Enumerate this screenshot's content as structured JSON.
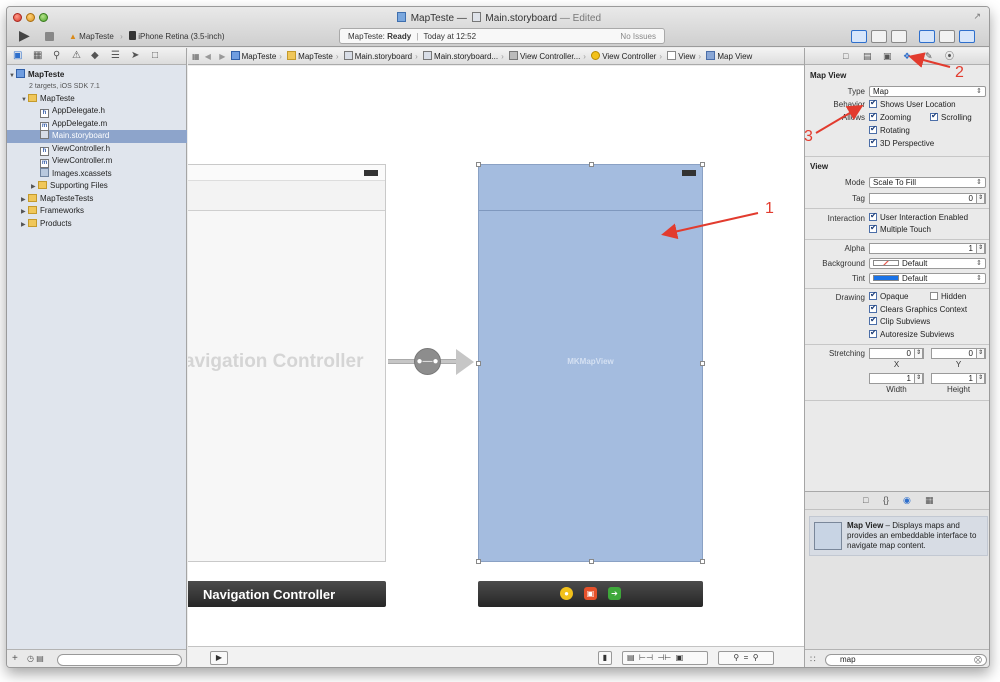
{
  "window": {
    "project": "MapTeste",
    "separator": "—",
    "file": "Main.storyboard",
    "edited": "— Edited"
  },
  "toolbar": {
    "scheme": "MapTeste",
    "device": "iPhone Retina (3.5-inch)",
    "status_project": "MapTeste:",
    "status_state": "Ready",
    "status_time": "Today at 12:52",
    "issues": "No Issues"
  },
  "navigator": {
    "project_name": "MapTeste",
    "project_sub": "2 targets, iOS SDK 7.1",
    "items": [
      {
        "label": "MapTeste",
        "type": "folder"
      },
      {
        "label": "AppDelegate.h",
        "type": "h"
      },
      {
        "label": "AppDelegate.m",
        "type": "m"
      },
      {
        "label": "Main.storyboard",
        "type": "storyboard"
      },
      {
        "label": "ViewController.h",
        "type": "h"
      },
      {
        "label": "ViewController.m",
        "type": "m"
      },
      {
        "label": "Images.xcassets",
        "type": "assets"
      },
      {
        "label": "Supporting Files",
        "type": "folder"
      },
      {
        "label": "MapTesteTests",
        "type": "folder"
      },
      {
        "label": "Frameworks",
        "type": "folder"
      },
      {
        "label": "Products",
        "type": "folder"
      }
    ]
  },
  "jumpbar": [
    "MapTeste",
    "MapTeste",
    "Main.storyboard",
    "Main.storyboard...",
    "View Controller...",
    "View Controller",
    "View",
    "Map View"
  ],
  "canvas": {
    "nav_scene_title": "avigation Controller",
    "nav_label": "Navigation Controller",
    "mapview_label": "MKMapView"
  },
  "annotations": {
    "one": "1",
    "two": "2",
    "three": "3"
  },
  "inspector": {
    "mapview_section": "Map View",
    "type_label": "Type",
    "type_value": "Map",
    "behavior_label": "Behavior",
    "shows_user_location": "Shows User Location",
    "allows_label": "Allows",
    "zooming": "Zooming",
    "scrolling": "Scrolling",
    "rotating": "Rotating",
    "perspective": "3D Perspective",
    "view_section": "View",
    "mode_label": "Mode",
    "mode_value": "Scale To Fill",
    "tag_label": "Tag",
    "tag_value": "0",
    "interaction_label": "Interaction",
    "user_interaction": "User Interaction Enabled",
    "multiple_touch": "Multiple Touch",
    "alpha_label": "Alpha",
    "alpha_value": "1",
    "background_label": "Background",
    "background_value": "Default",
    "tint_label": "Tint",
    "tint_value": "Default",
    "drawing_label": "Drawing",
    "opaque": "Opaque",
    "hidden": "Hidden",
    "clears_context": "Clears Graphics Context",
    "clip_subviews": "Clip Subviews",
    "autoresize": "Autoresize Subviews",
    "stretching_label": "Stretching",
    "stretch_x": "0",
    "stretch_y": "0",
    "stretch_w": "1",
    "stretch_h": "1",
    "x_label": "X",
    "y_label": "Y",
    "width_label": "Width",
    "height_label": "Height"
  },
  "library": {
    "item_title": "Map View",
    "item_desc": " – Displays maps and provides an embeddable interface to navigate map content.",
    "search_value": "map"
  },
  "colors": {
    "mapview_fill": "#a4bcdf",
    "selection": "#8da4cb",
    "annotation_red": "#e23b2e",
    "accent_blue": "#2e6fcc"
  }
}
